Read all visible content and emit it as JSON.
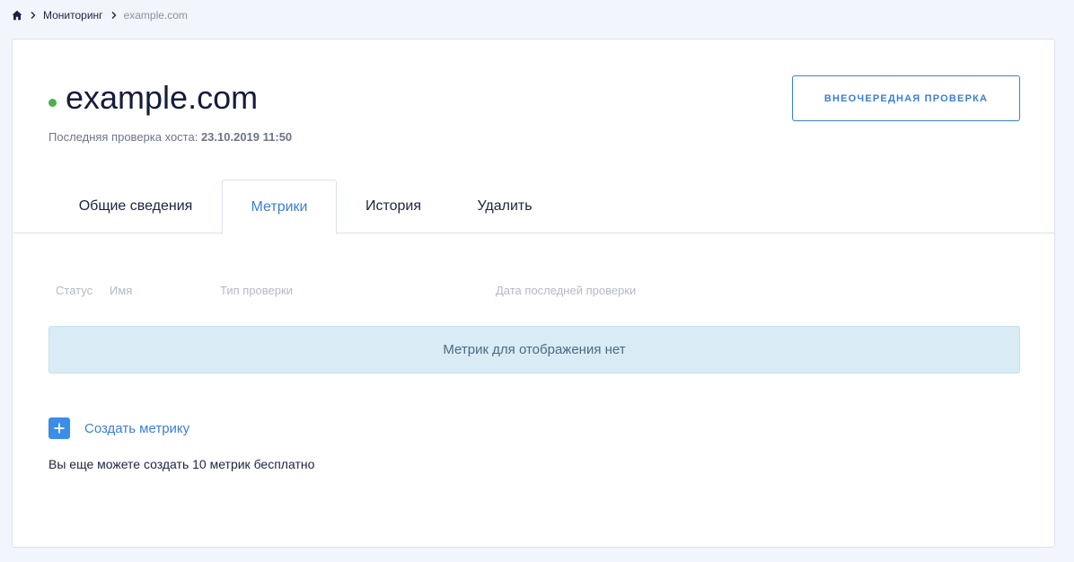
{
  "breadcrumb": {
    "home_icon": "home-icon",
    "separator_icon": "chevron-right-icon",
    "items": [
      "Мониторинг",
      "example.com"
    ]
  },
  "host": {
    "name": "example.com",
    "status_color": "#4caf50",
    "last_check_label": "Последняя проверка хоста:",
    "last_check_value": "23.10.2019 11:50"
  },
  "actions": {
    "extra_check_label": "ВНЕОЧЕРЕДНАЯ ПРОВЕРКА"
  },
  "tabs": [
    {
      "label": "Общие сведения",
      "active": false
    },
    {
      "label": "Метрики",
      "active": true
    },
    {
      "label": "История",
      "active": false
    },
    {
      "label": "Удалить",
      "active": false
    }
  ],
  "metrics_table": {
    "columns": [
      "Статус",
      "Имя",
      "Тип проверки",
      "Дата последней проверки"
    ],
    "empty_message": "Метрик для отображения нет"
  },
  "create": {
    "icon": "plus-icon",
    "label": "Создать метрику",
    "note": "Вы еще можете создать 10 метрик бесплатно"
  },
  "colors": {
    "accent": "#3d7fd0",
    "plus_button": "#3b8de9",
    "empty_box_bg": "#d9ecf5",
    "page_bg": "#f2f5fb"
  }
}
